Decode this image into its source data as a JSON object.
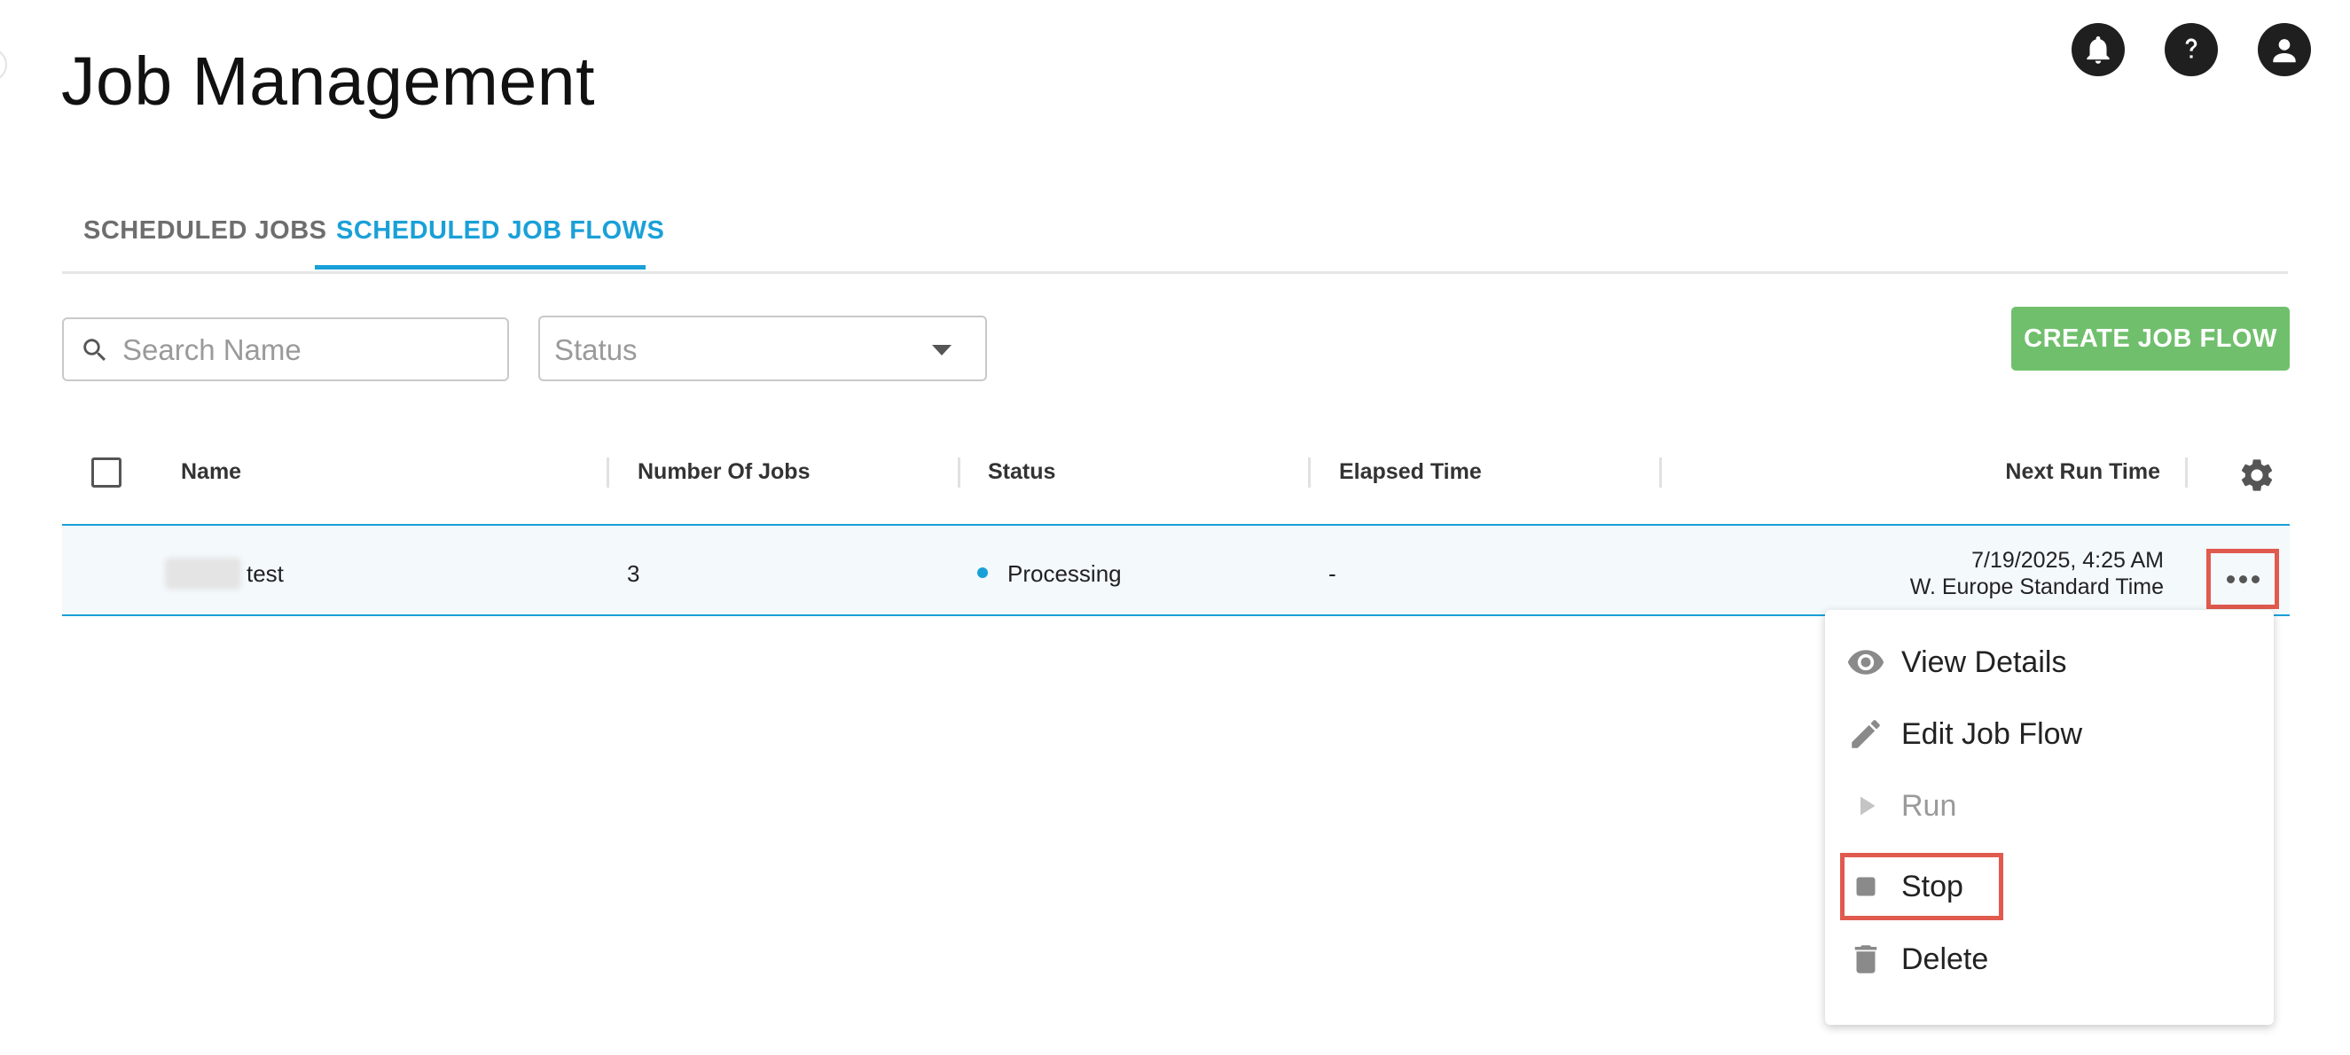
{
  "header": {
    "title": "Job Management",
    "icons": [
      "bell-icon",
      "help-icon",
      "user-icon"
    ]
  },
  "tabs": [
    {
      "label": "SCHEDULED JOBS",
      "active": false
    },
    {
      "label": "SCHEDULED JOB FLOWS",
      "active": true
    }
  ],
  "filters": {
    "search_placeholder": "Search Name",
    "status_placeholder": "Status"
  },
  "actions": {
    "create_label": "CREATE JOB FLOW"
  },
  "table": {
    "columns": [
      "Name",
      "Number Of Jobs",
      "Status",
      "Elapsed Time",
      "Next Run Time"
    ],
    "rows": [
      {
        "name": "test",
        "number_of_jobs": "3",
        "status": "Processing",
        "elapsed_time": "-",
        "next_run_date": "7/19/2025, 4:25 AM",
        "next_run_tz": "W. Europe Standard Time"
      }
    ]
  },
  "row_menu": {
    "items": [
      {
        "label": "View Details",
        "icon": "eye-icon",
        "disabled": false
      },
      {
        "label": "Edit Job Flow",
        "icon": "pencil-icon",
        "disabled": false
      },
      {
        "label": "Run",
        "icon": "play-icon",
        "disabled": true
      },
      {
        "label": "Stop",
        "icon": "stop-icon",
        "disabled": false,
        "highlighted": true
      },
      {
        "label": "Delete",
        "icon": "trash-icon",
        "disabled": false
      }
    ]
  },
  "colors": {
    "accent": "#1aa0d8",
    "create_button": "#70bf6c",
    "highlight": "#e05a4e",
    "status_processing": "#1aa0d8"
  }
}
